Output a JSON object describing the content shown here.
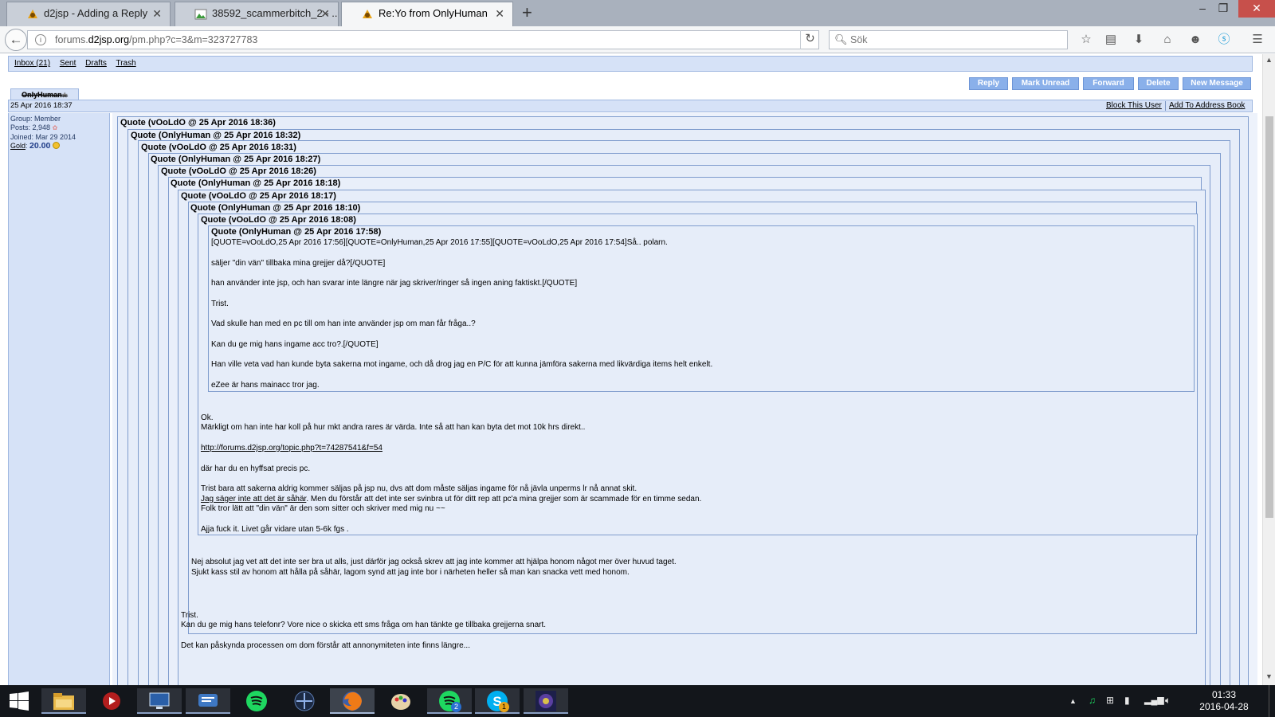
{
  "browser": {
    "tabs": [
      {
        "title": "d2jsp - Adding a Reply",
        "active": false
      },
      {
        "title": "38592_scammerbitch_2 - ...",
        "active": false
      },
      {
        "title": "Re:Yo from OnlyHuman",
        "active": true
      }
    ],
    "url": {
      "prefix": "forums.",
      "host": "d2jsp.org",
      "path": "/pm.php?c=3&m=323727783"
    },
    "search_placeholder": "Sök",
    "window_controls": [
      "–",
      "❐",
      "✕"
    ],
    "toolbar_icons": [
      "star-icon",
      "reader-icon",
      "download-icon",
      "home-icon",
      "hello-icon",
      "skype-icon",
      "menu-icon"
    ]
  },
  "pm_nav": [
    {
      "label": "Inbox (21)"
    },
    {
      "label": "Sent"
    },
    {
      "label": "Drafts"
    },
    {
      "label": "Trash"
    }
  ],
  "actions": [
    "Reply",
    "Mark Unread",
    "Forward",
    "Delete",
    "New Message"
  ],
  "message": {
    "author": "OnlyHuman",
    "date": "25 Apr 2016 18:37",
    "block_link": "Block This User",
    "address_link": "Add To Address Book"
  },
  "author_info": {
    "group": "Group: Member",
    "posts": "Posts: 2,948",
    "joined": "Joined: Mar 29 2014",
    "gold_label": "Gold",
    "gold_sep": ":",
    "gold_value": "20.00"
  },
  "quotes": [
    {
      "header": "Quote (vOoLdO @ 25 Apr 2016 18:36)"
    },
    {
      "header": "Quote (OnlyHuman @ 25 Apr 2016 18:32)"
    },
    {
      "header": "Quote (vOoLdO @ 25 Apr 2016 18:31)"
    },
    {
      "header": "Quote (OnlyHuman @ 25 Apr 2016 18:27)"
    },
    {
      "header": "Quote (vOoLdO @ 25 Apr 2016 18:26)"
    },
    {
      "header": "Quote (OnlyHuman @ 25 Apr 2016 18:18)"
    },
    {
      "header": "Quote (vOoLdO @ 25 Apr 2016 18:17)"
    },
    {
      "header": "Quote (OnlyHuman @ 25 Apr 2016 18:10)"
    },
    {
      "header": "Quote (vOoLdO @ 25 Apr 2016 18:08)"
    },
    {
      "header": "Quote (OnlyHuman @ 25 Apr 2016 17:58)"
    }
  ],
  "lines": [
    {
      "text": "[QUOTE=vOoLdO,25 Apr 2016 17:56][QUOTE=OnlyHuman,25 Apr 2016 17:55][QUOTE=vOoLdO,25 Apr 2016 17:54]Så.. polarn."
    },
    {
      "text": "säljer \"din vän\" tillbaka mina grejjer då?[/QUOTE]"
    },
    {
      "text": "han använder inte jsp, och han svarar inte längre när jag skriver/ringer så ingen aning faktiskt.[/QUOTE]"
    },
    {
      "text": "Trist."
    },
    {
      "text": "Vad skulle han med en pc till om han inte använder jsp om man får fråga..?"
    },
    {
      "text": "Kan du ge mig hans ingame acc tro?.[/QUOTE]"
    },
    {
      "text": "Han ville veta vad han kunde byta sakerna mot ingame, och då drog jag en P/C för att kunna jämföra sakerna med likvärdiga items helt enkelt."
    },
    {
      "text": "eZee är hans mainacc tror jag."
    },
    {
      "text": "Ok."
    },
    {
      "text": "Märkligt om han inte har koll på hur mkt andra rares är värda. Inte så att han kan byta det mot 10k hrs direkt.."
    },
    {
      "text": "http://forums.d2jsp.org/topic.php?t=74287541&f=54"
    },
    {
      "text": "där har du en hyffsat precis pc."
    },
    {
      "text": "Trist bara att sakerna aldrig kommer säljas på jsp nu, dvs att dom måste säljas ingame för nå jävla unperms lr nå annat skit."
    },
    {
      "text": "Jag säger inte att det är såhär"
    },
    {
      "text": ". Men du förstår att det inte ser svinbra ut för ditt rep att pc'a mina grejjer som är scammade för en timme sedan."
    },
    {
      "text": "Folk tror lätt att \"din vän\" är den som sitter och skriver med mig nu ~~"
    },
    {
      "text": "Ajja fuck it. Livet går vidare utan 5-6k fgs ."
    },
    {
      "text": "Nej absolut jag vet att det inte ser bra ut alls, just därför jag också skrev att jag inte kommer att hjälpa honom något mer över huvud taget."
    },
    {
      "text": "Sjukt kass stil av honom att hålla på såhär, lagom synd att jag inte bor i närheten heller så man kan snacka vett med honom."
    },
    {
      "text": "Trist."
    },
    {
      "text": "Kan du ge mig hans telefonr? Vore nice o skicka ett sms fråga om han tänkte ge tillbaka grejjerna snart."
    },
    {
      "text": "Det kan påskynda processen om dom förstår att annonymiteten inte finns längre..."
    }
  ],
  "taskbar": {
    "apps": [
      {
        "name": "start-icon",
        "state": "idle"
      },
      {
        "name": "file-explorer-icon",
        "state": "run"
      },
      {
        "name": "media-player-icon",
        "state": "idle"
      },
      {
        "name": "remote-desktop-icon",
        "state": "run"
      },
      {
        "name": "chat-app-icon",
        "state": "run"
      },
      {
        "name": "spotify-icon",
        "state": "idle"
      },
      {
        "name": "diablo-icon",
        "state": "idle"
      },
      {
        "name": "firefox-icon",
        "state": "act"
      },
      {
        "name": "paint-icon",
        "state": "idle"
      },
      {
        "name": "spotify-alt-icon",
        "state": "run"
      },
      {
        "name": "skype-icon",
        "state": "run"
      },
      {
        "name": "game-app-icon",
        "state": "run"
      }
    ],
    "badges": {
      "spotify": "2",
      "skype": "1"
    },
    "time": "01:33",
    "date": "2016-04-28"
  },
  "colors": {
    "panel": "#d6e2f7",
    "panel_border": "#9fb7e0",
    "button": "#8ab0ea",
    "quote_border": "#7f9ccd",
    "quote_bg": "#e6edf9"
  }
}
